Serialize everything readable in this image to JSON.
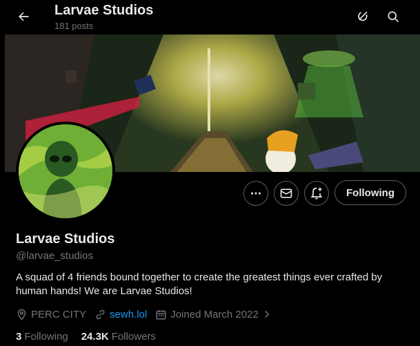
{
  "header": {
    "title": "Larvae Studios",
    "posts_count": "181 posts"
  },
  "icons": {
    "back": "arrow-left-icon",
    "grok": "grok-icon",
    "search": "search-icon",
    "more": "more-icon",
    "message": "envelope-icon",
    "notify": "bell-plus-icon",
    "location": "location-pin-icon",
    "link": "link-icon",
    "calendar": "calendar-icon",
    "chevron": "chevron-right-icon"
  },
  "actions": {
    "following_label": "Following"
  },
  "profile": {
    "name": "Larvae Studios",
    "handle": "@larvae_studios",
    "bio": "A squad of 4 friends bound together to create the greatest things ever crafted by human hands! We are Larvae Studios!",
    "location": "PERC CITY",
    "website": "sewh.lol",
    "joined": "Joined March 2022"
  },
  "stats": {
    "following_count": "3",
    "following_label": "Following",
    "followers_count": "24.3K",
    "followers_label": "Followers"
  },
  "colors": {
    "background": "#000000",
    "text_primary": "#e7e9ea",
    "text_secondary": "#71767b",
    "link": "#1d9bf0",
    "border": "#536471"
  }
}
